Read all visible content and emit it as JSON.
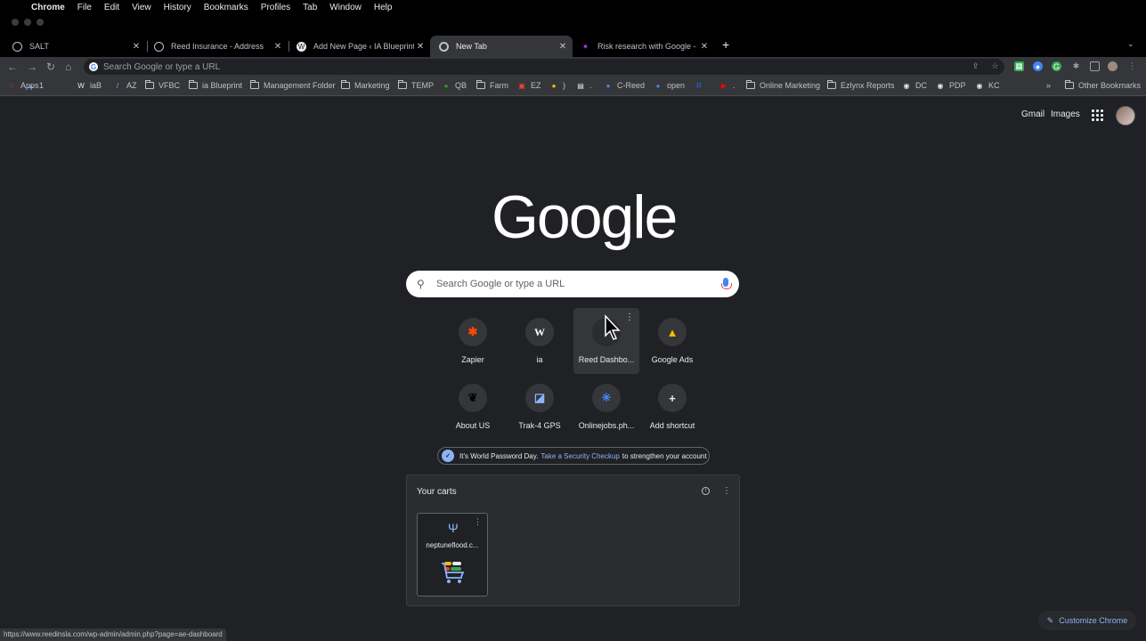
{
  "menubar": {
    "items": [
      "Chrome",
      "File",
      "Edit",
      "View",
      "History",
      "Bookmarks",
      "Profiles",
      "Tab",
      "Window",
      "Help"
    ]
  },
  "tabs": [
    {
      "title": "SALT",
      "icon": "globe-icon"
    },
    {
      "title": "Reed Insurance - Address",
      "icon": "globe-icon"
    },
    {
      "title": "Add New Page ‹ IA Blueprint —",
      "icon": "wordpress-icon"
    },
    {
      "title": "New Tab",
      "icon": "chrome-icon",
      "active": true
    },
    {
      "title": "Risk research with Google - M",
      "icon": "sparkle-icon"
    }
  ],
  "omnibox": {
    "placeholder": "Search Google or type a URL"
  },
  "bookmarks": [
    {
      "label": "Apps",
      "icon": "apps-grid-icon"
    },
    {
      "label": "1",
      "icon": "cloud-icon"
    },
    {
      "label": "iaB",
      "icon": "wordpress-icon"
    },
    {
      "label": "AZ",
      "icon": "slash-icon"
    },
    {
      "label": "VFBC",
      "icon": "folder-icon"
    },
    {
      "label": "ia Blueprint",
      "icon": "folder-icon"
    },
    {
      "label": "Management Folder",
      "icon": "folder-icon"
    },
    {
      "label": "Marketing",
      "icon": "folder-icon"
    },
    {
      "label": "TEMP",
      "icon": "folder-icon"
    },
    {
      "label": "QB",
      "icon": "quickbooks-icon"
    },
    {
      "label": "Farm",
      "icon": "folder-icon"
    },
    {
      "label": "EZ",
      "icon": "ez-icon"
    },
    {
      "label": ")",
      "icon": "bee-icon"
    },
    {
      "label": ".",
      "icon": "sheet-icon"
    },
    {
      "label": "C-Reed",
      "icon": "c-icon"
    },
    {
      "label": "open",
      "icon": "c-icon"
    },
    {
      "label": "",
      "icon": "r-icon"
    },
    {
      "label": ".",
      "icon": "youtube-icon"
    },
    {
      "label": "Online Marketing",
      "icon": "folder-icon"
    },
    {
      "label": "Ezlynx Reports",
      "icon": "folder-icon"
    },
    {
      "label": "DC",
      "icon": "globe-icon"
    },
    {
      "label": "PDP",
      "icon": "globe-icon"
    },
    {
      "label": "KC",
      "icon": "globe-icon"
    }
  ],
  "bookmarks_overflow": "»",
  "other_bookmarks": "Other Bookmarks",
  "header_links": {
    "gmail": "Gmail",
    "images": "Images"
  },
  "logo": "Google",
  "search": {
    "placeholder": "Search Google or type a URL"
  },
  "shortcuts": [
    {
      "label": "Zapier",
      "icon": "zapier-icon",
      "glyph": "✱",
      "color": "#ff4a00"
    },
    {
      "label": "ia",
      "icon": "wordpress-icon",
      "glyph": "W",
      "color": "#ffffff"
    },
    {
      "label": "Reed Dashbo...",
      "icon": "reed-dashboard-icon",
      "glyph": "",
      "color": "#ffffff"
    },
    {
      "label": "Google Ads",
      "icon": "google-ads-icon",
      "glyph": "▲",
      "color": "#fbbc04"
    },
    {
      "label": "About US",
      "icon": "bird-icon",
      "glyph": "❦",
      "color": "#000000"
    },
    {
      "label": "Trak-4 GPS",
      "icon": "trak4-icon",
      "glyph": "◪",
      "color": "#8ab4f8"
    },
    {
      "label": "Onlinejobs.ph...",
      "icon": "onlinejobs-icon",
      "glyph": "✳",
      "color": "#4285f4"
    },
    {
      "label": "Add shortcut",
      "icon": "plus-icon",
      "glyph": "+",
      "color": "#e8eaed"
    }
  ],
  "promo": {
    "prefix": "It's World Password Day.",
    "link": "Take a Security Checkup",
    "suffix": "to strengthen your account"
  },
  "carts": {
    "title": "Your carts",
    "items": [
      {
        "label": "neptuneflood.c..."
      }
    ]
  },
  "customize": "Customize Chrome",
  "status_url": "https://www.reedinsla.com/wp-admin/admin.php?page=ae-dashboard"
}
